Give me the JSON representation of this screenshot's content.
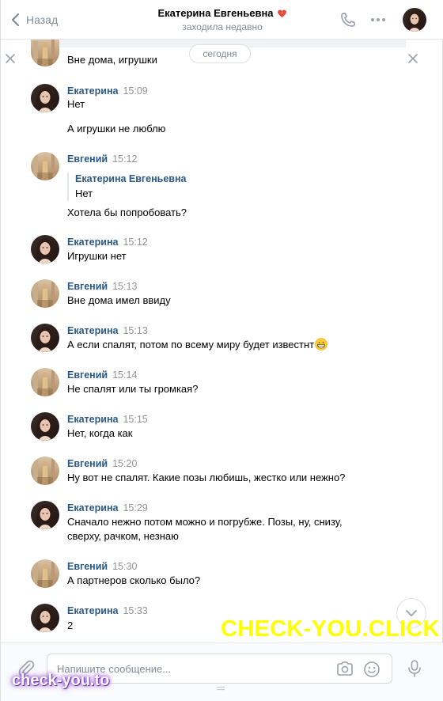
{
  "header": {
    "back_label": "Назад",
    "chat_title": "Екатерина Евгеньевна",
    "status": "заходила недавно"
  },
  "date_separator": "сегодня",
  "messages": [
    {
      "author": "",
      "time": "",
      "lines": [
        "Вне дома, игрушки"
      ],
      "who": "evgeny"
    },
    {
      "author": "Екатерина",
      "time": "15:09",
      "lines": [
        "Нет",
        "А игрушки не люблю"
      ],
      "who": "katya"
    },
    {
      "author": "Евгений",
      "time": "15:12",
      "quote_author": "Екатерина Евгеньевна",
      "quote_text": "Нет",
      "lines": [
        "Хотела бы попробовать?"
      ],
      "who": "evgeny"
    },
    {
      "author": "Екатерина",
      "time": "15:12",
      "lines": [
        "Игрушки нет"
      ],
      "who": "katya"
    },
    {
      "author": "Евгений",
      "time": "15:13",
      "lines": [
        "Вне дома имел ввиду"
      ],
      "who": "evgeny"
    },
    {
      "author": "Екатерина",
      "time": "15:13",
      "lines": [
        "А если спалят, потом по всему миру будет известнт"
      ],
      "emoji": "grinning-face-emoji",
      "who": "katya"
    },
    {
      "author": "Евгений",
      "time": "15:14",
      "lines": [
        "Не спалят или ты громкая?"
      ],
      "who": "evgeny"
    },
    {
      "author": "Екатерина",
      "time": "15:15",
      "lines": [
        "Нет, когда как"
      ],
      "who": "katya"
    },
    {
      "author": "Евгений",
      "time": "15:20",
      "lines": [
        "Ну вот не спалят. Какие позы любишь, жестко или нежно?"
      ],
      "who": "evgeny"
    },
    {
      "author": "Екатерина",
      "time": "15:29",
      "lines": [
        "Сначало нежно потом можно и погрубже. Позы, ну, снизу,",
        "сверху, рачком, незнаю"
      ],
      "who": "katya"
    },
    {
      "author": "Евгений",
      "time": "15:30",
      "lines": [
        "А партнеров сколько было?"
      ],
      "who": "evgeny"
    },
    {
      "author": "Екатерина",
      "time": "15:33",
      "lines": [
        "2"
      ],
      "who": "katya"
    }
  ],
  "composer": {
    "placeholder": "Напишите сообщение..."
  },
  "watermarks": {
    "big": "CHECK-YOU.CLICK",
    "small": "check-you.to"
  },
  "icons": {
    "back": "chevron-left-icon",
    "call": "phone-icon",
    "more": "more-dots-icon",
    "close": "close-icon",
    "scroll": "chevron-down-icon",
    "attach": "paperclip-icon",
    "camera": "camera-icon",
    "emoji": "smile-icon",
    "voice": "microphone-icon"
  },
  "colors": {
    "link": "#2a5885",
    "muted": "#818c99",
    "watermark_big": "#ffff00",
    "watermark_small_glow": "#8a3fd1"
  }
}
